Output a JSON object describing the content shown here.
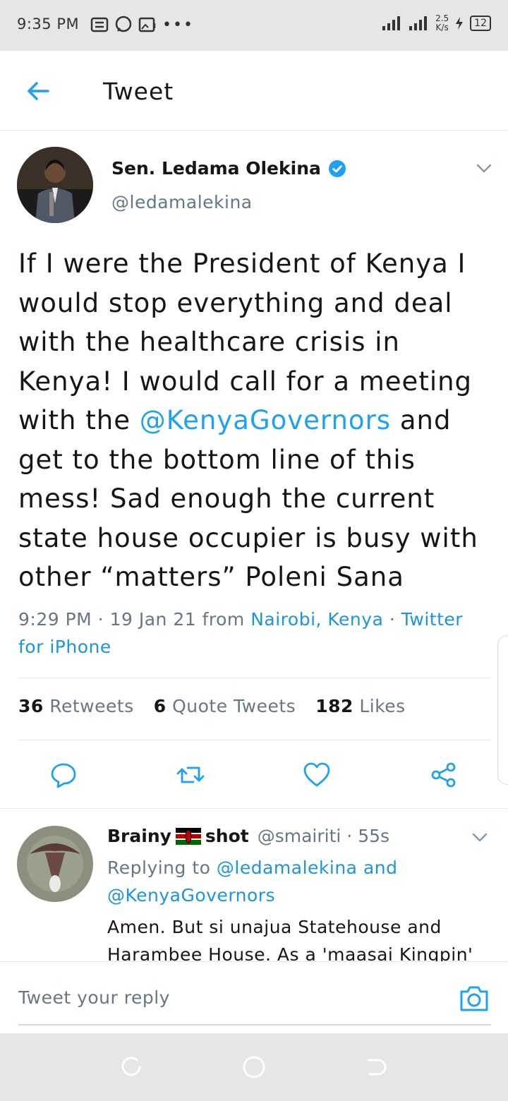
{
  "status_bar": {
    "time": "9:35 PM",
    "dots": "•••",
    "speed_value": "2.5",
    "speed_unit": "K/s",
    "battery": "12"
  },
  "header": {
    "title": "Tweet"
  },
  "tweet": {
    "author_name": "Sen. Ledama Olekina",
    "author_handle": "@ledamalekina",
    "text_before": "If I were the President of Kenya I would stop everything and deal with the healthcare crisis in Kenya! I would call for a meeting with the ",
    "mention": "@KenyaGovernors",
    "text_after": " and get to the bottom line of this mess! Sad enough the current state house occupier is busy with other “matters” Poleni Sana",
    "time": "9:29 PM · 19 Jan 21 from ",
    "location": "Nairobi, Kenya",
    "separator": " · ",
    "source": "Twitter for iPhone",
    "stats": {
      "retweets_count": "36",
      "retweets_label": "Retweets",
      "quotes_count": "6",
      "quotes_label": "Quote Tweets",
      "likes_count": "182",
      "likes_label": "Likes"
    }
  },
  "reply": {
    "name_part1": "Brainy",
    "name_part2": "shot",
    "handle_time": "@smairiti · 55s",
    "replying_prefix": "Replying to ",
    "replying_user1": "@ledamalekina",
    "replying_and": " and ",
    "replying_user2": "@KenyaGovernors",
    "text": "Amen. But si unajua Statehouse and Harambee House. As a 'maasai Kingpin' you should..."
  },
  "composer": {
    "placeholder": "Tweet your reply"
  },
  "colors": {
    "accent": "#1da1f2",
    "muted": "#657786",
    "text": "#14171a",
    "verified": "#1da1f2"
  }
}
